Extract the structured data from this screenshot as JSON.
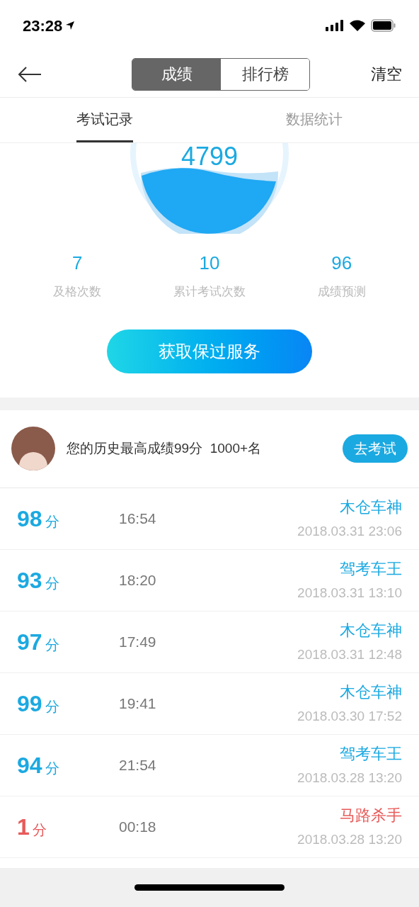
{
  "status_bar": {
    "time": "23:28"
  },
  "nav": {
    "segments": [
      {
        "label": "成绩",
        "selected": true
      },
      {
        "label": "排行榜",
        "selected": false
      }
    ],
    "action": "清空"
  },
  "tabs": [
    {
      "label": "考试记录",
      "selected": true
    },
    {
      "label": "数据统计",
      "selected": false
    }
  ],
  "gauge": {
    "value": "4799"
  },
  "stats": [
    {
      "value": "7",
      "label": "及格次数"
    },
    {
      "value": "10",
      "label": "累计考试次数"
    },
    {
      "value": "96",
      "label": "成绩预测"
    }
  ],
  "service_button": "获取保过服务",
  "best": {
    "text": "您的历史最高成绩99分  1000+名",
    "button": "去考试"
  },
  "records": [
    {
      "score": "98",
      "unit": "分",
      "duration": "16:54",
      "title": "木仓车神",
      "date": "2018.03.31 23:06",
      "color": "#1ba9e1"
    },
    {
      "score": "93",
      "unit": "分",
      "duration": "18:20",
      "title": "驾考车王",
      "date": "2018.03.31 13:10",
      "color": "#1ba9e1"
    },
    {
      "score": "97",
      "unit": "分",
      "duration": "17:49",
      "title": "木仓车神",
      "date": "2018.03.31 12:48",
      "color": "#1ba9e1"
    },
    {
      "score": "99",
      "unit": "分",
      "duration": "19:41",
      "title": "木仓车神",
      "date": "2018.03.30 17:52",
      "color": "#1ba9e1"
    },
    {
      "score": "94",
      "unit": "分",
      "duration": "21:54",
      "title": "驾考车王",
      "date": "2018.03.28 13:20",
      "color": "#1ba9e1"
    },
    {
      "score": "1",
      "unit": "分",
      "duration": "00:18",
      "title": "马路杀手",
      "date": "2018.03.28 13:20",
      "color": "#e85a5a"
    }
  ]
}
